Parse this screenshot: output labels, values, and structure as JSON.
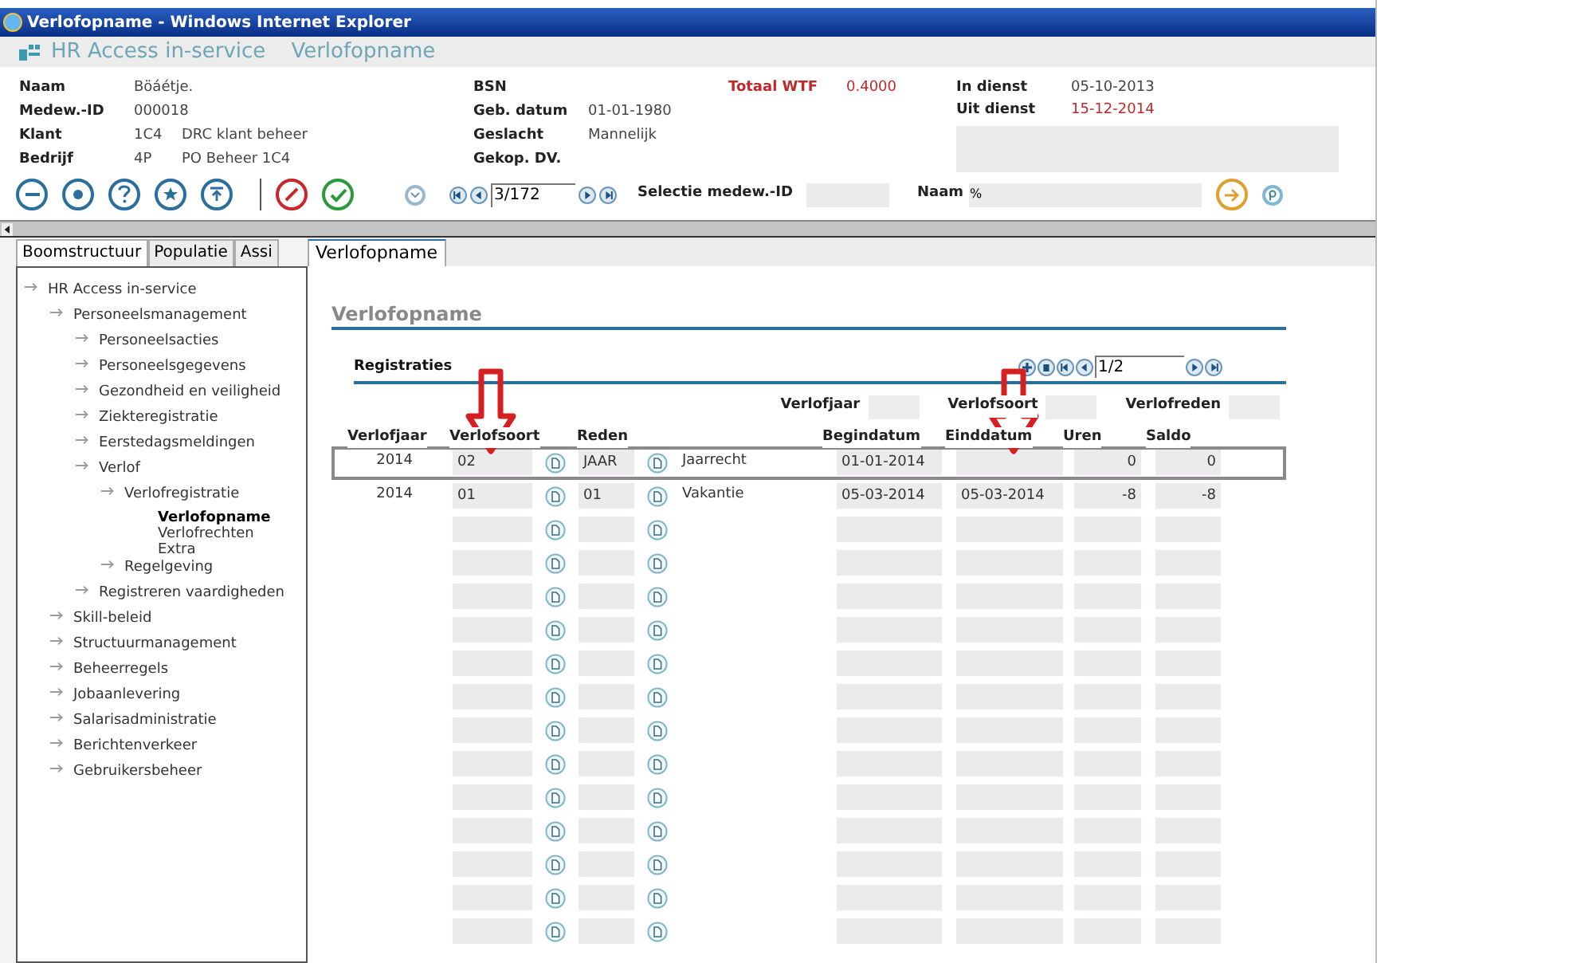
{
  "window": {
    "title": "Verlofopname - Windows Internet Explorer"
  },
  "header": {
    "app_name": "HR Access in-service",
    "page_name": "Verlofopname"
  },
  "info": {
    "columns": [
      [
        {
          "label": "Naam",
          "label_alert": false,
          "values": [
            "Böáétje."
          ],
          "alert": false
        },
        {
          "label": "Medew.-ID",
          "label_alert": false,
          "values": [
            "000018"
          ],
          "alert": false
        },
        {
          "label": "Klant",
          "label_alert": false,
          "values": [
            "1C4",
            "DRC klant beheer"
          ],
          "alert": false
        },
        {
          "label": "Bedrijf",
          "label_alert": false,
          "values": [
            "4P",
            "PO Beheer 1C4"
          ],
          "alert": false
        }
      ],
      [
        {
          "label": "BSN",
          "label_alert": false
        },
        {
          "label": "Geb. datum",
          "label_alert": false,
          "values": [
            "01-01-1980"
          ],
          "alert": false
        },
        {
          "label": "Geslacht",
          "label_alert": false,
          "values": [
            "Mannelijk"
          ],
          "alert": false
        },
        {
          "label": "Gekop. DV.",
          "label_alert": false
        }
      ],
      [
        {
          "label": "Totaal WTF",
          "label_alert": true,
          "values": [
            "0.4000"
          ],
          "alert": true
        }
      ],
      [
        {
          "label": "In dienst",
          "label_alert": false,
          "values": [
            "05-10-2013"
          ],
          "alert": false
        },
        {
          "label": "Uit dienst",
          "label_alert": false,
          "values": [
            "15-12-2014"
          ],
          "alert": true
        }
      ]
    ]
  },
  "toolbar": {
    "record": "3/172",
    "selection_label": "Selectie medew.-ID",
    "name_label": "Naam",
    "name_value": "%"
  },
  "left_tabs": [
    {
      "label": "Boomstructuur",
      "selected": true
    },
    {
      "label": "Populatie",
      "selected": false
    },
    {
      "label": "Assi",
      "selected": false
    }
  ],
  "right_tabs": [
    {
      "label": "Verlofopname",
      "selected": true
    }
  ],
  "tree": [
    {
      "label": "HR Access in-service",
      "kind": "node",
      "selected": false,
      "children": [
        {
          "label": "Personeelsmanagement",
          "kind": "node",
          "selected": false,
          "children": [
            {
              "label": "Personeelsacties",
              "kind": "node",
              "selected": false
            },
            {
              "label": "Personeelsgegevens",
              "kind": "node",
              "selected": false
            },
            {
              "label": "Gezondheid en veiligheid",
              "kind": "node",
              "selected": false
            },
            {
              "label": "Ziekteregistratie",
              "kind": "node",
              "selected": false
            },
            {
              "label": "Eerstedagsmeldingen",
              "kind": "node",
              "selected": false
            },
            {
              "label": "Verlof",
              "kind": "node",
              "selected": false,
              "children": [
                {
                  "label": "Verlofregistratie",
                  "kind": "node",
                  "selected": false,
                  "children": [
                    {
                      "label": "Verlofopname",
                      "kind": "leaf",
                      "selected": true
                    },
                    {
                      "label": "Verlofrechten",
                      "kind": "leaf",
                      "selected": false
                    },
                    {
                      "label": "Extra",
                      "kind": "leaf",
                      "selected": false
                    }
                  ]
                },
                {
                  "label": "Regelgeving",
                  "kind": "node",
                  "selected": false
                }
              ]
            },
            {
              "label": "Registreren vaardigheden",
              "kind": "node",
              "selected": false
            }
          ]
        },
        {
          "label": "Skill-beleid",
          "kind": "node",
          "selected": false
        },
        {
          "label": "Structuurmanagement",
          "kind": "node",
          "selected": false
        },
        {
          "label": "Beheerregels",
          "kind": "node",
          "selected": false
        },
        {
          "label": "Jobaanlevering",
          "kind": "node",
          "selected": false
        },
        {
          "label": "Salarisadministratie",
          "kind": "node",
          "selected": false
        },
        {
          "label": "Berichtenverkeer",
          "kind": "node",
          "selected": false
        },
        {
          "label": "Gebruikersbeheer",
          "kind": "node",
          "selected": false
        }
      ]
    }
  ],
  "content": {
    "title": "Verlofopname",
    "section": "Registraties",
    "pager": "1/2",
    "filters": [
      {
        "label": "Verlofjaar"
      },
      {
        "label": "Verlofsoort"
      },
      {
        "label": "Verlofreden"
      }
    ],
    "columns": [
      "Verlofjaar",
      "Verlofsoort",
      "Reden",
      "Begindatum",
      "Einddatum",
      "Uren",
      "Saldo"
    ],
    "rows": [
      {
        "kind": "filled",
        "selected": true,
        "year": "2014",
        "type": "02",
        "reason": "JAAR",
        "description": "Jaarrecht",
        "start": "01-01-2014",
        "end": "",
        "hours": "0",
        "balance": "0"
      },
      {
        "kind": "filled",
        "selected": false,
        "year": "2014",
        "type": "01",
        "reason": "01",
        "description": "Vakantie",
        "start": "05-03-2014",
        "end": "05-03-2014",
        "hours": "-8",
        "balance": "-8"
      },
      {
        "kind": "blank",
        "selected": false
      },
      {
        "kind": "blank",
        "selected": false
      },
      {
        "kind": "blank",
        "selected": false
      },
      {
        "kind": "blank",
        "selected": false
      },
      {
        "kind": "blank",
        "selected": false
      },
      {
        "kind": "blank",
        "selected": false
      },
      {
        "kind": "blank",
        "selected": false
      },
      {
        "kind": "blank",
        "selected": false
      },
      {
        "kind": "blank",
        "selected": false
      },
      {
        "kind": "blank",
        "selected": false
      },
      {
        "kind": "blank",
        "selected": false
      },
      {
        "kind": "blank",
        "selected": false
      },
      {
        "kind": "blank",
        "selected": false
      }
    ]
  }
}
